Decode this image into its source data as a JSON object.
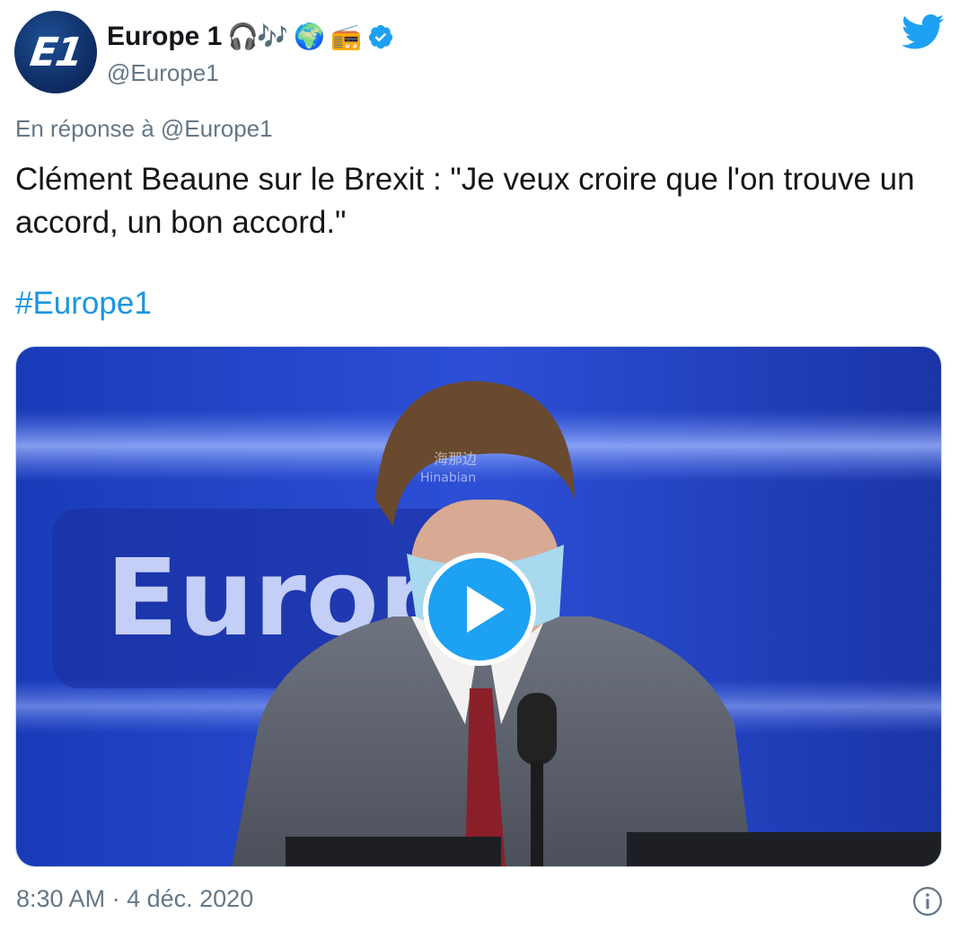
{
  "account": {
    "avatar_text": "E1",
    "display_name": "Europe 1",
    "emojis": [
      "🎧",
      "🎶",
      "🌍",
      "📻"
    ],
    "handle": "@Europe1"
  },
  "tweet": {
    "reply_prefix": "En réponse à",
    "reply_to": "@Europe1",
    "text": "Clément Beaune sur le Brexit : \"Je veux croire que l'on trouve un accord, un bon accord.\"",
    "hashtag": "#Europe1"
  },
  "media": {
    "type": "video",
    "background_logo_text": "Europe",
    "watermark_cn": "海那边",
    "watermark_en": "Hinabian"
  },
  "footer": {
    "time": "8:30 AM",
    "separator": "·",
    "date": "4 déc. 2020"
  },
  "colors": {
    "twitter_blue": "#1da1f2",
    "hashtag_blue": "#1b95e0",
    "muted_text": "#657786",
    "studio_blue": "#1f3fbf"
  },
  "icons": {
    "brand": "twitter-bird-icon",
    "verified": "verified-badge-icon",
    "play": "play-icon",
    "info": "info-icon"
  }
}
